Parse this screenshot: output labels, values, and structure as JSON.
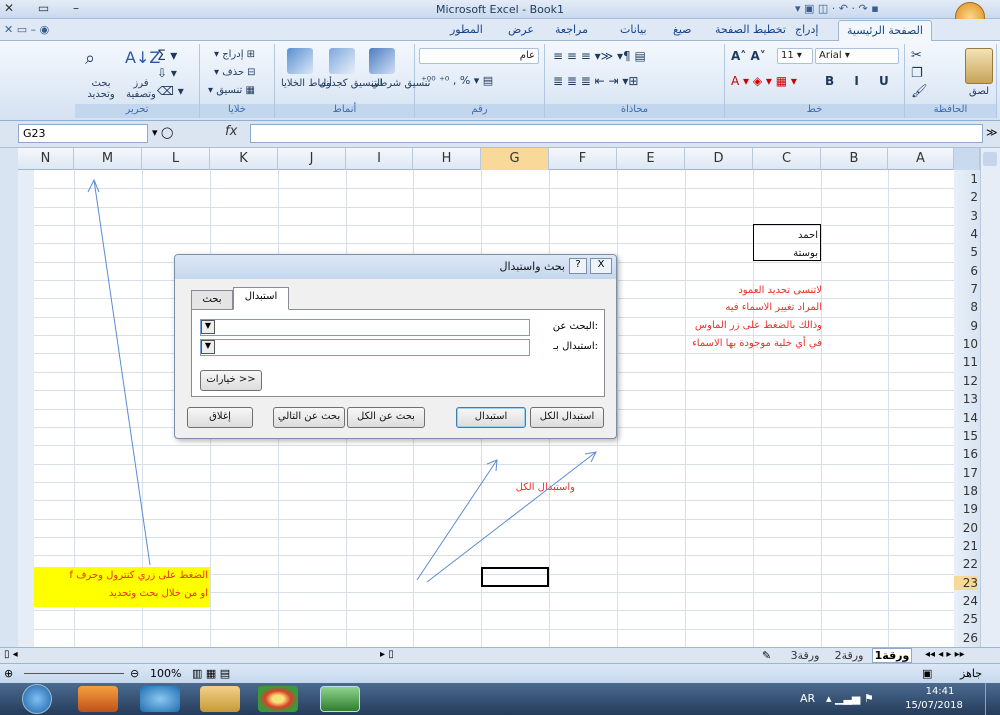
{
  "window": {
    "title": "Microsoft Excel - Book1"
  },
  "ribbon": {
    "tabs": [
      "الصفحة الرئيسية",
      "إدراج",
      "تخطيط الصفحة",
      "صيغ",
      "بيانات",
      "مراجعة",
      "عرض",
      "المطور"
    ],
    "groups": {
      "clipboard": "الحافظة",
      "font": "خط",
      "alignment": "محاذاة",
      "number": "رقم",
      "styles": "أنماط",
      "cells": "خلايا",
      "editing": "تحرير"
    },
    "font_name": "Arial",
    "font_size": "11",
    "number_format": "عام",
    "paste": "لصق",
    "styles_buttons": [
      "تنسيق شرطي",
      "التنسيق كجدول",
      "أنماط الخلايا"
    ],
    "cells_buttons": [
      "إدراج",
      "حذف",
      "تنسيق"
    ],
    "editing_buttons": [
      "فرز وتصفية",
      "بحث وتحديد"
    ]
  },
  "formula_bar": {
    "name_box": "G23",
    "fx": "fx"
  },
  "columns": [
    "N",
    "M",
    "L",
    "K",
    "J",
    "I",
    "H",
    "G",
    "F",
    "E",
    "D",
    "C",
    "B",
    "A"
  ],
  "rows": [
    "1",
    "2",
    "3",
    "4",
    "5",
    "6",
    "7",
    "8",
    "9",
    "10",
    "11",
    "12",
    "13",
    "14",
    "15",
    "16",
    "17",
    "18",
    "19",
    "20",
    "21",
    "22",
    "23",
    "24",
    "25",
    "26"
  ],
  "cells": {
    "c4": "احمد",
    "c5": "بوستة"
  },
  "notes": {
    "red1": "لاتنسى تحديد العمود",
    "red2": "المراد تغيير الاسماء فيه",
    "red3": "وذالك بالضغط على زر الماوس",
    "red4": "في أي خلية موجودة بها الاسماء",
    "replace_all": "واستبدال الكل",
    "yellow1": "الضغط على زري كنترول وحرف f",
    "yellow2": "او من خلال بحث وتحديد"
  },
  "dialog": {
    "title": "بحث واستبدال",
    "help": "?",
    "close": "X",
    "tab_find": "بحث",
    "tab_replace": "استبدال",
    "find_label": "البحث عن:",
    "replace_label": "استبدال بـ:",
    "options": "خيارات >>",
    "btn_replace_all": "استبدال الكل",
    "btn_replace": "استبدال",
    "btn_find_all": "بحث عن الكل",
    "btn_find_next": "بحث عن التالي",
    "btn_close": "إغلاق"
  },
  "sheets": [
    "ورقة1",
    "ورقة2",
    "ورقة3"
  ],
  "status": {
    "ready": "جاهز",
    "zoom": "100%"
  },
  "taskbar": {
    "lang": "AR",
    "time": "14:41",
    "date": "15/07/2018"
  }
}
